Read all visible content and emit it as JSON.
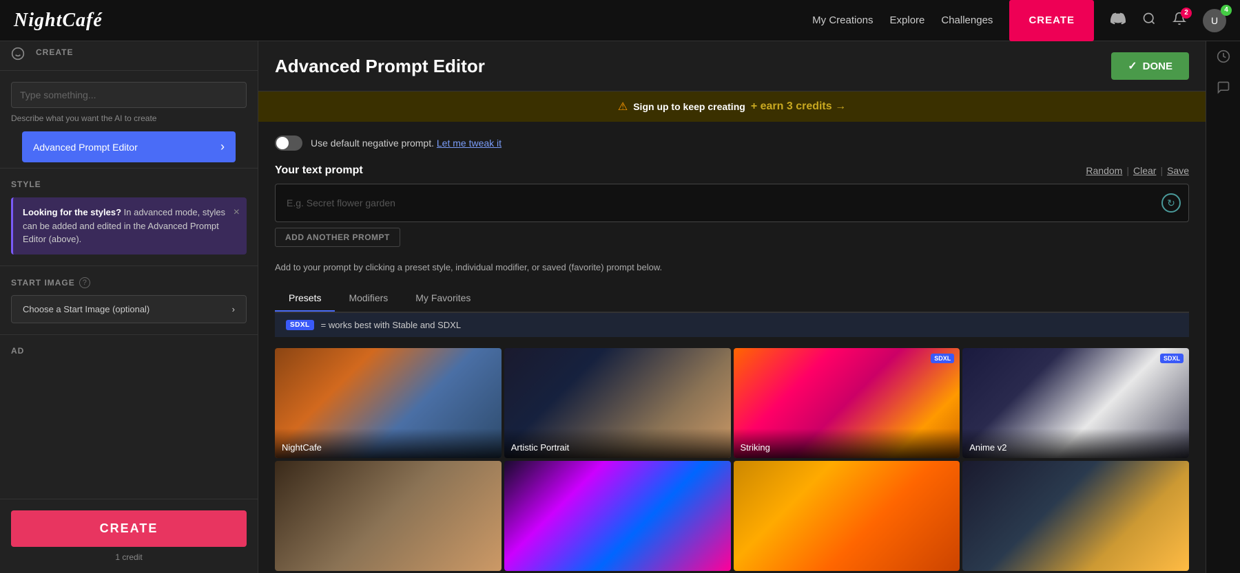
{
  "app": {
    "logo": "NightCafé",
    "nav": {
      "my_creations": "My Creations",
      "explore": "Explore",
      "challenges": "Challenges",
      "create_btn": "CREATE"
    },
    "notification_count": "2",
    "avatar_count": "4"
  },
  "sidebar": {
    "section_label": "CREATE",
    "type_placeholder": "Type something...",
    "describe_text": "Describe what you want the AI to create",
    "advanced_btn": "Advanced Prompt Editor",
    "style_label": "STYLE",
    "style_info": {
      "bold_text": "Looking for the styles?",
      "rest_text": " In advanced mode, styles can be added and edited in the Advanced Prompt Editor (above)."
    },
    "start_image_label": "START IMAGE",
    "choose_btn": "Choose a Start Image (optional)",
    "ad_label": "AD",
    "create_btn": "CREATE",
    "credit_text": "1 credit"
  },
  "content": {
    "title": "Advanced Prompt Editor",
    "done_btn": "DONE",
    "banner": {
      "warning_icon": "⚠",
      "text_part1": "Sign up to keep creating",
      "text_part2": "+ earn 3 credits →"
    },
    "neg_prompt": {
      "label": "Use default negative prompt.",
      "link_text": "Let me tweak it"
    },
    "prompt_section": {
      "label": "Your text prompt",
      "random_link": "Random",
      "clear_link": "Clear",
      "save_link": "Save",
      "placeholder": "E.g. Secret flower garden",
      "add_another": "ADD ANOTHER PROMPT"
    },
    "preset_desc": "Add to your prompt by clicking a preset style, individual modifier, or saved (favorite) prompt below.",
    "tabs": [
      "Presets",
      "Modifiers",
      "My Favorites"
    ],
    "active_tab": 0,
    "sdxl_banner": "= works best with Stable and SDXL",
    "image_cards": [
      {
        "label": "NightCafe",
        "sdxl": false,
        "style": "img-nightcafe"
      },
      {
        "label": "Artistic Portrait",
        "sdxl": false,
        "style": "img-portrait"
      },
      {
        "label": "Striking",
        "sdxl": true,
        "style": "img-striking"
      },
      {
        "label": "Anime v2",
        "sdxl": true,
        "style": "img-anime"
      },
      {
        "label": "",
        "sdxl": false,
        "style": "img-old"
      },
      {
        "label": "",
        "sdxl": false,
        "style": "img-neon"
      },
      {
        "label": "",
        "sdxl": false,
        "style": "img-landscape"
      },
      {
        "label": "",
        "sdxl": false,
        "style": "img-city"
      }
    ]
  }
}
